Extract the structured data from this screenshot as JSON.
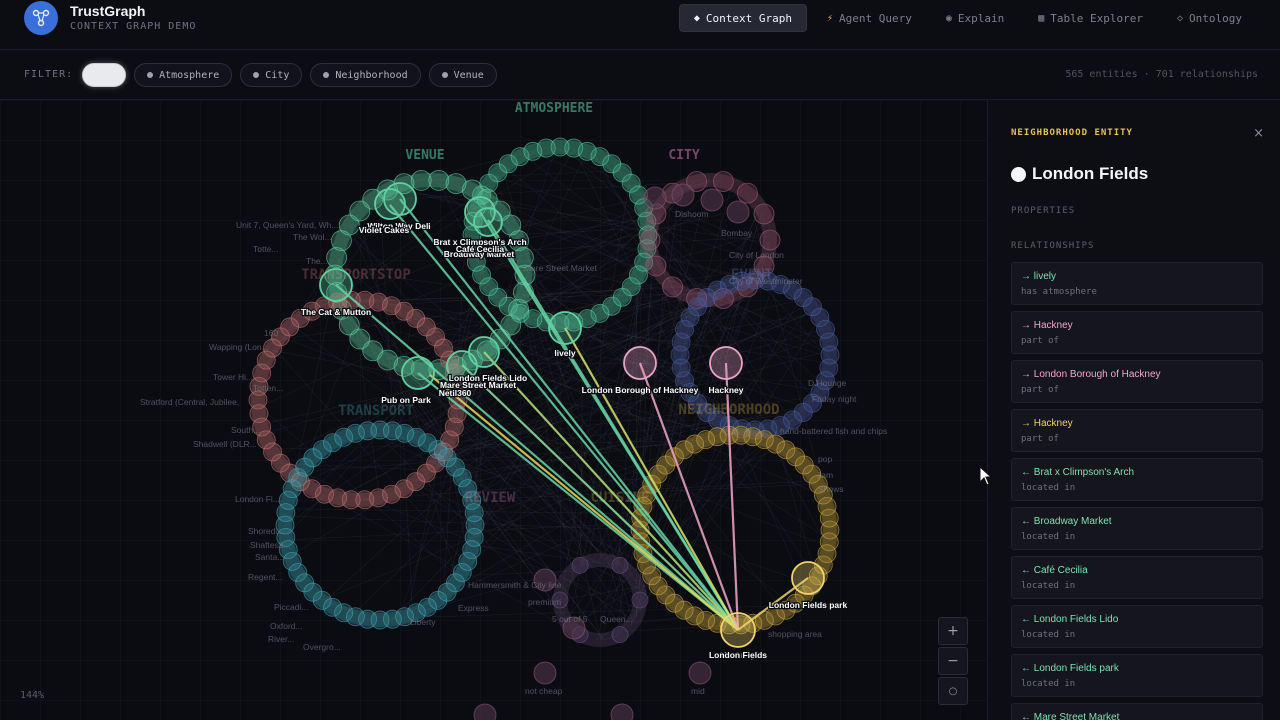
{
  "app": {
    "title": "TrustGraph",
    "subtitle": "CONTEXT GRAPH DEMO"
  },
  "nav": [
    {
      "icon": "◆",
      "label": "Context Graph",
      "active": true
    },
    {
      "icon": "⚡",
      "label": "Agent Query",
      "active": false
    },
    {
      "icon": "◉",
      "label": "Explain",
      "active": false
    },
    {
      "icon": "▦",
      "label": "Table Explorer",
      "active": false
    },
    {
      "icon": "◇",
      "label": "Ontology",
      "active": false
    }
  ],
  "filter": {
    "label": "FILTER:",
    "chips": [
      "All",
      "Atmosphere",
      "City",
      "Neighborhood",
      "Venue"
    ],
    "active": "All"
  },
  "stats": "565 entities · 701 relationships",
  "graph": {
    "zoom": "144%",
    "clusters": [
      {
        "label": "ATMOSPHERE",
        "color": "#5fd0a2"
      },
      {
        "label": "VENUE",
        "color": "#5fd0a2"
      },
      {
        "label": "CITY",
        "color": "#d07aa0"
      },
      {
        "label": "EVENT",
        "color": "#6b80c8"
      },
      {
        "label": "NEIGHBORHOOD",
        "color": "#d4b34a"
      },
      {
        "label": "TRANSPORTSTOP",
        "color": "#d07a7a"
      },
      {
        "label": "TRANSPORT",
        "color": "#4aaec0"
      },
      {
        "label": "REVIEW",
        "color": "#d07aa0"
      },
      {
        "label": "CUISINE",
        "color": "#d4b34a"
      }
    ],
    "highlight_labels": [
      "Wilton Way Deli",
      "Violet Cakes",
      "Brat x Climpson's Arch",
      "Broadway Market",
      "Café Cecilia",
      "The Cat & Mutton",
      "lively",
      "London Borough of Hackney",
      "Hackney",
      "Pub on Park",
      "Netil360",
      "London Fields Lido",
      "Mare Street Market",
      "London Fields park",
      "Hackney",
      "London Fields"
    ],
    "faint_labels": [
      "Unit 7, Queen's Yard, Wh...",
      "The Wol...",
      "Totte...",
      "The...",
      "160",
      "Wapping (Lon...",
      "Tower Hi...",
      "Totten...",
      "Stratford (Central, Jubilee,",
      "South...",
      "Shadwell (DLR...",
      "London Fi...",
      "Shoredi...",
      "Shaftesb...",
      "Santa...",
      "Regent...",
      "Piccadi...",
      "Oxford...",
      "River...",
      "Overgro...",
      "City of London",
      "City of Westminster",
      "Bombay",
      "Dishoom",
      "Mare Street Market",
      "Friday night",
      "DJ lounge",
      "hand-battered fish and chips",
      "Shows",
      "premium",
      "5 out of 5",
      "not cheap",
      "mid",
      "Queen...",
      "shopping area",
      "Hammersmith & City line",
      "Express",
      "Liberty",
      "Jam",
      "pop"
    ],
    "controls": [
      "+",
      "−",
      "○"
    ]
  },
  "panel": {
    "type": "NEIGHBORHOOD ENTITY",
    "close": "×",
    "title": "London Fields",
    "properties_label": "PROPERTIES",
    "relationships_label": "RELATIONSHIPS",
    "relationships": [
      {
        "name": "→ lively",
        "type": "has atmosphere",
        "color": "green"
      },
      {
        "name": "→ Hackney",
        "type": "part of",
        "color": "pink"
      },
      {
        "name": "→ London Borough of Hackney",
        "type": "part of",
        "color": "pink"
      },
      {
        "name": "→ Hackney",
        "type": "part of",
        "color": "yellow"
      },
      {
        "name": "← Brat x Climpson's Arch",
        "type": "located in",
        "color": "green"
      },
      {
        "name": "← Broadway Market",
        "type": "located in",
        "color": "green"
      },
      {
        "name": "← Café Cecilia",
        "type": "located in",
        "color": "green"
      },
      {
        "name": "← London Fields Lido",
        "type": "located in",
        "color": "green"
      },
      {
        "name": "← London Fields park",
        "type": "located in",
        "color": "green"
      },
      {
        "name": "← Mare Street Market",
        "type": "located in",
        "color": "green"
      }
    ]
  }
}
